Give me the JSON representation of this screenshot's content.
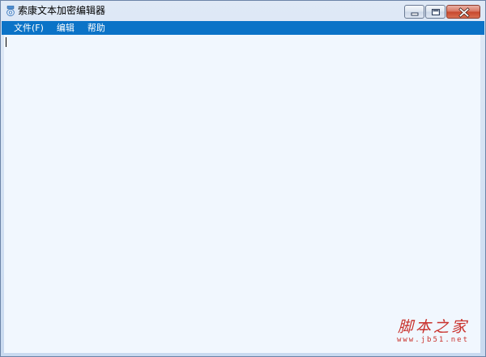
{
  "window": {
    "title": "索康文本加密编辑器",
    "icon": "app-icon"
  },
  "caption_buttons": {
    "minimize": "minimize-icon",
    "maximize": "maximize-icon",
    "close": "close-icon"
  },
  "menu": {
    "items": [
      {
        "label": "文件(F)"
      },
      {
        "label": "编辑"
      },
      {
        "label": "帮助"
      }
    ]
  },
  "editor": {
    "value": ""
  },
  "watermark": {
    "brand": "脚本之家",
    "url": "www.jb51.net",
    "color": "#c9312c"
  },
  "colors": {
    "menubar": "#0b73c7",
    "editor_background": "#f1f7fe"
  }
}
